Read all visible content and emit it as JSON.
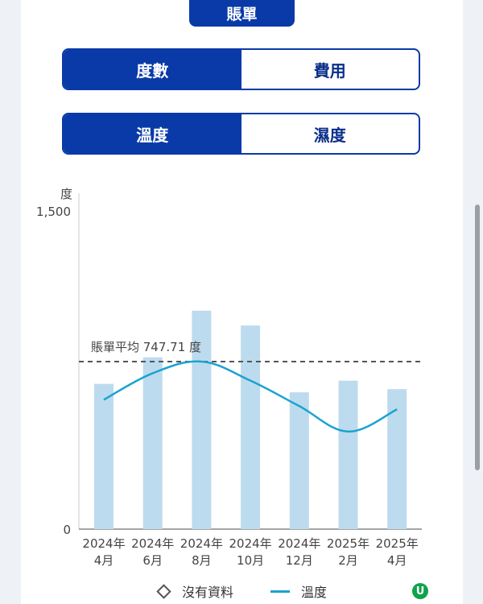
{
  "header": {
    "title": "賬單"
  },
  "metric_toggle": {
    "options": [
      "度數",
      "費用"
    ],
    "selected": 0
  },
  "weather_toggle": {
    "options": [
      "溫度",
      "濕度"
    ],
    "selected": 0
  },
  "colors": {
    "accent": "#0a3aa8",
    "bar": "#bddbee",
    "line": "#1aa3d1",
    "average": "#555555"
  },
  "chart_data": {
    "type": "bar",
    "y_unit": "度",
    "ylim": [
      0,
      1500
    ],
    "y_ticks": [
      "1,500",
      "0"
    ],
    "y_tick_values": [
      1500,
      0
    ],
    "categories": [
      [
        "2024年",
        "4月"
      ],
      [
        "2024年",
        "6月"
      ],
      [
        "2024年",
        "8月"
      ],
      [
        "2024年",
        "10月"
      ],
      [
        "2024年",
        "12月"
      ],
      [
        "2025年",
        "2月"
      ],
      [
        "2025年",
        "4月"
      ]
    ],
    "series": [
      {
        "type": "bar",
        "values": [
          685,
          810,
          1030,
          960,
          645,
          700,
          660
        ]
      },
      {
        "type": "line",
        "name": "溫度",
        "values": [
          610,
          735,
          790,
          700,
          580,
          460,
          565
        ]
      }
    ],
    "average": {
      "label": "賬單平均 747.71 度",
      "value": 790
    },
    "grid": false,
    "legend": {
      "placement": "bottom",
      "items": [
        "沒有資料",
        "溫度"
      ]
    }
  }
}
